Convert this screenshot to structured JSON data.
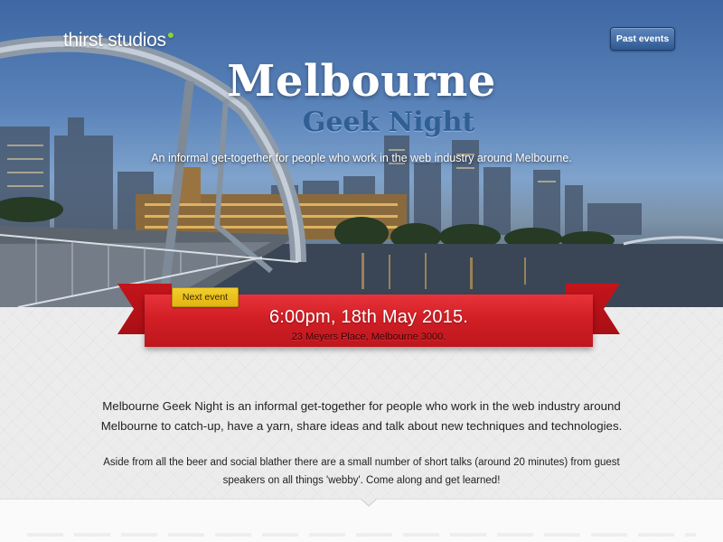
{
  "brand": {
    "name": "thirst studios",
    "dot": "●"
  },
  "nav": {
    "past_events_label": "Past events"
  },
  "hero": {
    "title": "Melbourne",
    "subtitle": "Geek Night",
    "tagline": "An informal get-together for people who work in the web industry around Melbourne."
  },
  "event": {
    "tag": "Next event",
    "datetime": "6:00pm, 18th May 2015.",
    "location": "23 Meyers Place, Melbourne 3000."
  },
  "about": {
    "intro": "Melbourne Geek Night is an informal get-together for people who work in the web industry around Melbourne to catch-up, have a yarn, share ideas and talk about new techniques and technologies.",
    "details": "Aside from all the beer and social blather there are a small number of short talks (around 20 minutes) from guest speakers on all things 'webby'. Come along and get learned!"
  },
  "colors": {
    "ribbon": "#d21f26",
    "tag": "#e9c21f",
    "brand_accent": "#8ed13a",
    "subtitle": "#2f5f95"
  }
}
